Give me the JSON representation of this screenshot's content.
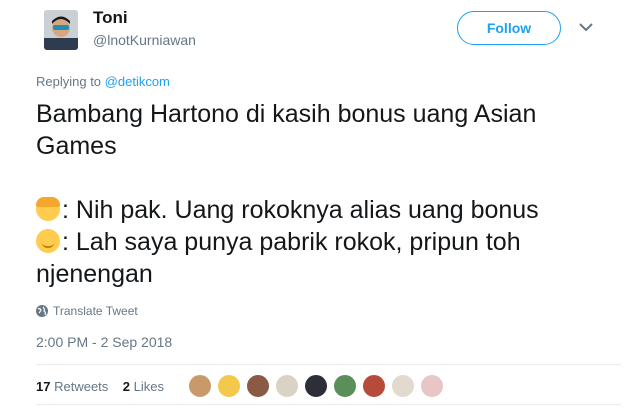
{
  "user": {
    "name": "Toni",
    "handle": "@lnotKurniawan"
  },
  "follow_label": "Follow",
  "reply": {
    "prefix": "Replying to",
    "mention": "@detikcom"
  },
  "tweet": {
    "line1": "Bambang Hartono di kasih bonus uang Asian Games",
    "line2_text": ": Nih pak. Uang rokoknya alias uang bonus",
    "line3_text": ": Lah saya punya pabrik rokok, pripun toh njenengan"
  },
  "translate_label": "Translate Tweet",
  "timestamp": "2:00 PM - 2 Sep 2018",
  "stats": {
    "retweets_count": "17",
    "retweets_label": "Retweets",
    "likes_count": "2",
    "likes_label": "Likes"
  },
  "liker_colors": [
    "#c89a6a",
    "#f2c94c",
    "#8a5a44",
    "#d9d2c5",
    "#2c2f3a",
    "#5a8f5a",
    "#b84a3a",
    "#e2d9cf",
    "#e8c6c6"
  ],
  "colors": {
    "accent": "#1da1f2",
    "secondary": "#657786",
    "text": "#14171a"
  },
  "icons": {
    "caret": "chevron-down-icon",
    "translate": "globe-icon"
  }
}
